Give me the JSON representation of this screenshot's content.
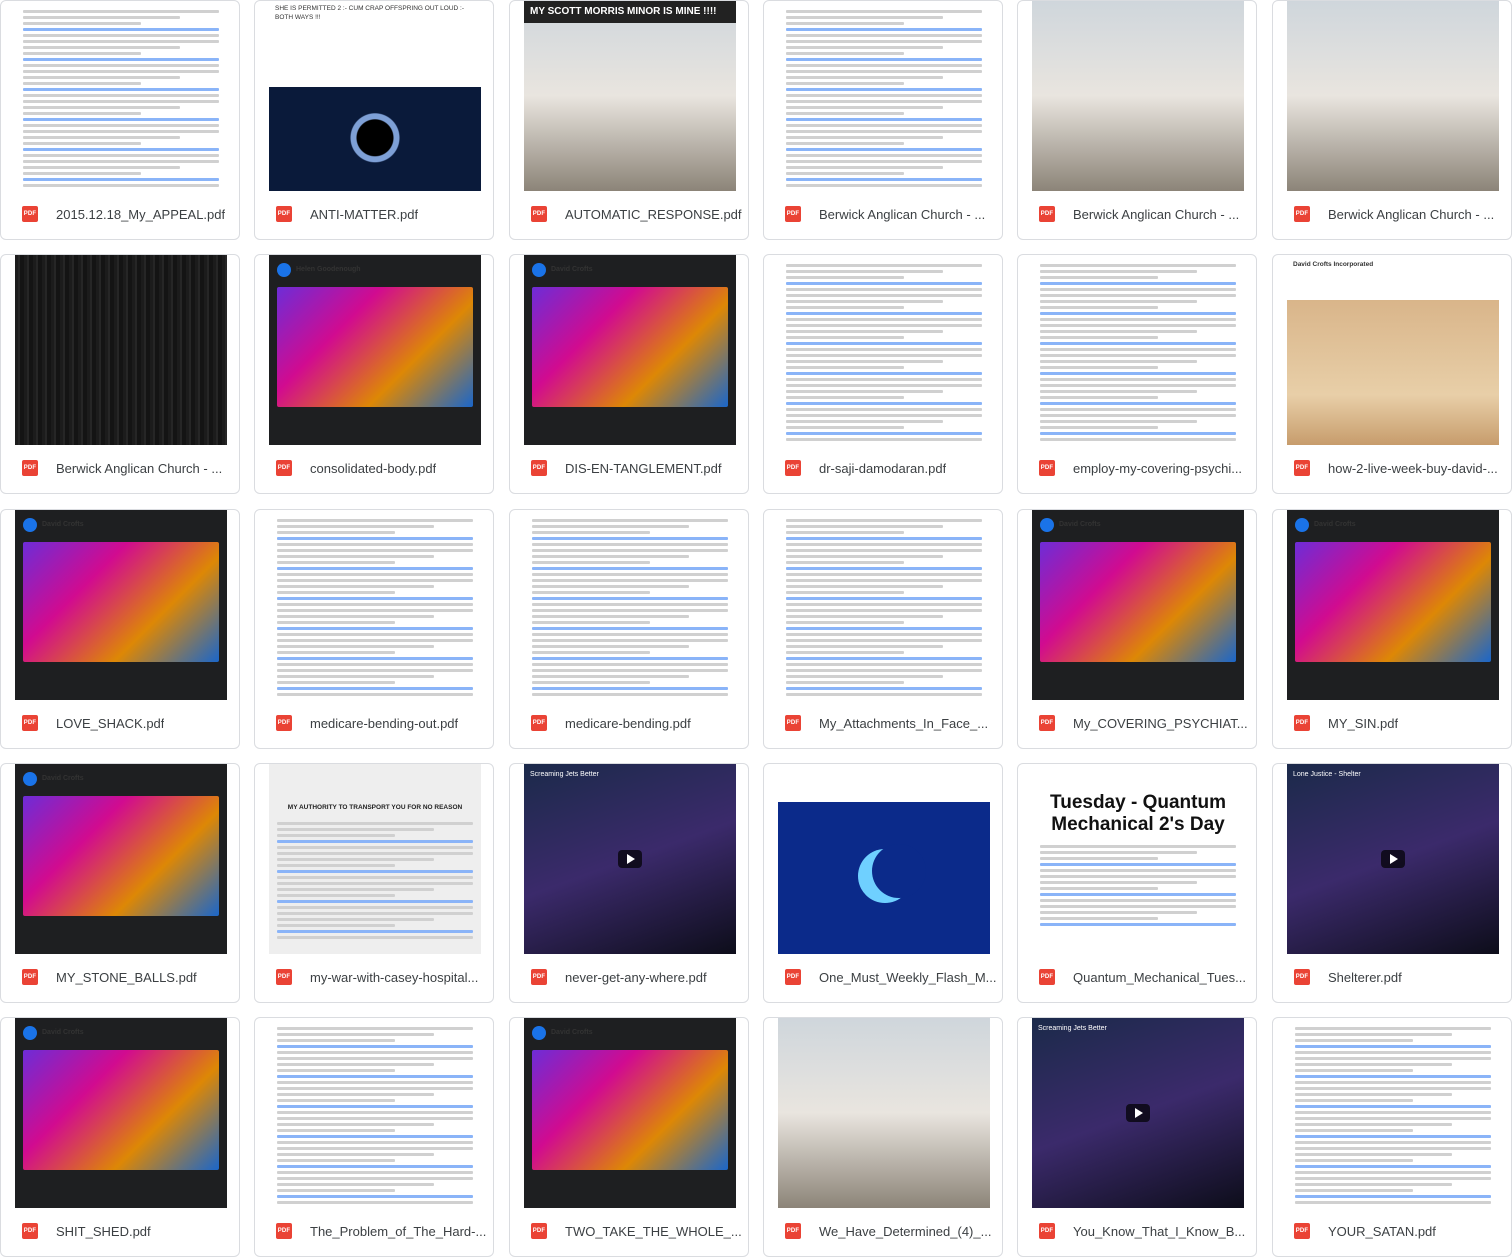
{
  "files": [
    {
      "name": "2015.12.18_My_APPEAL.pdf",
      "type_label": "PDF"
    },
    {
      "name": "ANTI-MATTER.pdf",
      "type_label": "PDF",
      "preview_text": "SHE IS PERMITTED 2 :- CUM CRAP OFFSPRING OUT LOUD :- BOTH WAYS !!!"
    },
    {
      "name": "AUTOMATIC_RESPONSE.pdf",
      "type_label": "PDF",
      "preview_text": "MY SCOTT MORRIS MINOR IS MINE !!!!"
    },
    {
      "name": "Berwick Anglican Church - ...",
      "type_label": "PDF"
    },
    {
      "name": "Berwick Anglican Church - ...",
      "type_label": "PDF"
    },
    {
      "name": "Berwick Anglican Church - ...",
      "type_label": "PDF"
    },
    {
      "name": "Berwick Anglican Church - ...",
      "type_label": "PDF"
    },
    {
      "name": "consolidated-body.pdf",
      "type_label": "PDF",
      "preview_text": "Helen Goodenough"
    },
    {
      "name": "DIS-EN-TANGLEMENT.pdf",
      "type_label": "PDF",
      "preview_text": "David Crofts"
    },
    {
      "name": "dr-saji-damodaran.pdf",
      "type_label": "PDF"
    },
    {
      "name": "employ-my-covering-psychi...",
      "type_label": "PDF",
      "preview_text": "David Crofts"
    },
    {
      "name": "how-2-live-week-buy-david-...",
      "type_label": "PDF",
      "preview_text": "David Crofts Incorporated"
    },
    {
      "name": "LOVE_SHACK.pdf",
      "type_label": "PDF",
      "preview_text": "David Crofts"
    },
    {
      "name": "medicare-bending-out.pdf",
      "type_label": "PDF"
    },
    {
      "name": "medicare-bending.pdf",
      "type_label": "PDF"
    },
    {
      "name": "My_Attachments_In_Face_...",
      "type_label": "PDF"
    },
    {
      "name": "My_COVERING_PSYCHIAT...",
      "type_label": "PDF",
      "preview_text": "David Crofts"
    },
    {
      "name": "MY_SIN.pdf",
      "type_label": "PDF",
      "preview_text": "David Crofts"
    },
    {
      "name": "MY_STONE_BALLS.pdf",
      "type_label": "PDF",
      "preview_text": "David Crofts"
    },
    {
      "name": "my-war-with-casey-hospital...",
      "type_label": "PDF",
      "preview_text": "MY AUTHORITY TO TRANSPORT YOU FOR NO REASON"
    },
    {
      "name": "never-get-any-where.pdf",
      "type_label": "PDF",
      "preview_text": "Screaming Jets Better"
    },
    {
      "name": "One_Must_Weekly_Flash_M...",
      "type_label": "PDF"
    },
    {
      "name": "Quantum_Mechanical_Tues...",
      "type_label": "PDF",
      "preview_text": "Tuesday - Quantum Mechanical 2's Day"
    },
    {
      "name": "Shelterer.pdf",
      "type_label": "PDF",
      "preview_text": "Lone Justice - Shelter"
    },
    {
      "name": "SHIT_SHED.pdf",
      "type_label": "PDF",
      "preview_text": "David Crofts"
    },
    {
      "name": "The_Problem_of_The_Hard-...",
      "type_label": "PDF"
    },
    {
      "name": "TWO_TAKE_THE_WHOLE_...",
      "type_label": "PDF",
      "preview_text": "David Crofts"
    },
    {
      "name": "We_Have_Determined_(4)_...",
      "type_label": "PDF"
    },
    {
      "name": "You_Know_That_I_Know_B...",
      "type_label": "PDF",
      "preview_text": "Screaming Jets Better"
    },
    {
      "name": "YOUR_SATAN.pdf",
      "type_label": "PDF",
      "preview_text": "RE :- my Sin to your Satan"
    }
  ],
  "colors": {
    "pdf_icon": "#ea4335",
    "card_border": "#dadce0",
    "filename": "#3c4043"
  }
}
